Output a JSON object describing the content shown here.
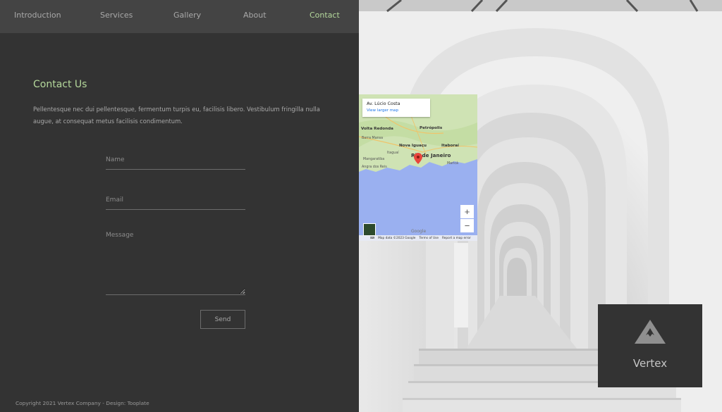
{
  "nav": {
    "items": [
      {
        "label": "Introduction"
      },
      {
        "label": "Services"
      },
      {
        "label": "Gallery"
      },
      {
        "label": "About"
      },
      {
        "label": "Contact"
      }
    ],
    "active": "Contact"
  },
  "contact": {
    "title": "Contact Us",
    "text": "Pellentesque nec dui pellentesque, fermentum turpis eu, facilisis libero. Vestibulum fringilla nulla augue, at consequat metus facilisis condimentum.",
    "form": {
      "name_placeholder": "Name",
      "email_placeholder": "Email",
      "message_placeholder": "Message",
      "send_label": "Send"
    }
  },
  "footer": {
    "copyright": "Copyright 2021 Vertex Company - Design: Tooplate"
  },
  "map": {
    "place": "Av. Lúcio Costa",
    "larger_map_link": "View larger map",
    "cities": [
      "Petrópolis",
      "Volta Redonda",
      "Nova Iguaçu",
      "Itaboraí",
      "Rio de Janeiro"
    ],
    "towns": [
      "Barra Mansa",
      "Itaguaí",
      "Maricá",
      "Mangaratiba",
      "Angra dos Reis"
    ],
    "zoom_in": "+",
    "zoom_out": "−",
    "logo_text": "Google",
    "attribution": "Map data ©2023 Google",
    "terms": "Terms of Use",
    "report": "Report a map error",
    "colors": {
      "water": "#9ab0f0",
      "land": "#cfe3b4",
      "pin": "#e8453c"
    }
  },
  "brand": {
    "name": "Vertex",
    "icon": "mountain-logo-icon"
  },
  "colors": {
    "accent": "#b5d99c",
    "panel": "#333333",
    "nav_bg": "#444444"
  }
}
